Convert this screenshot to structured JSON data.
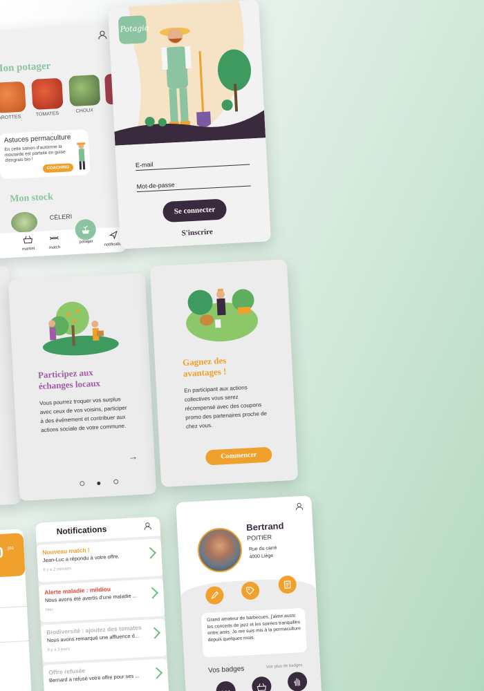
{
  "home": {
    "section_title": "Mon potager",
    "vegetables": [
      {
        "label": "CAROTTES",
        "color": "#d9662d"
      },
      {
        "label": "TOMATES",
        "color": "#c9412e"
      },
      {
        "label": "CHOUX",
        "color": "#6b8f52"
      }
    ],
    "tips_title": "Astuces permaculture",
    "tips_text": "En cette saison d'automne la moutarde est parfaite en guise d'engrais bio !",
    "tips_button": "COACHING",
    "stock_title": "Mon stock",
    "stock_item": "CÉLERI",
    "nav": {
      "market": "market",
      "match": "match",
      "potager": "potager",
      "notification": "notification"
    }
  },
  "login": {
    "logo": "Potagio",
    "email_label": "E-mail",
    "password_label": "Mot-de-passe",
    "connect_button": "Se connecter",
    "signup_link": "S'inscrire"
  },
  "onboarding1": {
    "title": "Participez aux échanges locaux",
    "text": "Vous pourrez troquer vos surplus avec ceux de vos voisins, participer à des événement et contribuer aux actions sociale de votre commune."
  },
  "onboarding2": {
    "title": "Gagnez des avantages !",
    "text": "En participant aux actions collectives vous serez récompensé avec des coupons promo des partenaires proche de chez vous.",
    "button": "Commencer"
  },
  "points": {
    "value": "0",
    "unit": "pts"
  },
  "notifications": {
    "title": "Notifications",
    "items": [
      {
        "title": "Nouveau match !",
        "text": "Jean-Luc a répondu à votre offre.",
        "time": "Il y a 2 minutes",
        "color": "#f0a02c"
      },
      {
        "title": "Alerte maladie : mildiou",
        "text": "Nous avons été avertis d'une maladie ...",
        "time": "Hier",
        "color": "#e0463a"
      },
      {
        "title": "Biodiversité : ajoutez des tomates",
        "text": "Nous avons remarqué une affluence d...",
        "time": "Il y a 3 jours",
        "color": "#b5b5b5"
      },
      {
        "title": "Offre refusée",
        "text": "Bernard a refusé votre offre pour ses ...",
        "time": "",
        "color": "#b5b5b5"
      }
    ]
  },
  "profile": {
    "first_name": "Bertrand",
    "last_name": "POITIER",
    "address_line1": "Rue du carré",
    "address_line2": "4000 Liège",
    "bio": "Grand amateur de barbecues, j'aime aussi les concerts de jazz et les soirées tranquilles entre amis. Je me suis mis à la permaculture depuis quelques mois.",
    "badges_title": "Vos badges",
    "more_badges": "Voir plus de badges"
  },
  "colors": {
    "green": "#8cc3a0",
    "orange": "#f0a02c",
    "purple": "#a05aa8",
    "dark": "#3a2a3d"
  }
}
